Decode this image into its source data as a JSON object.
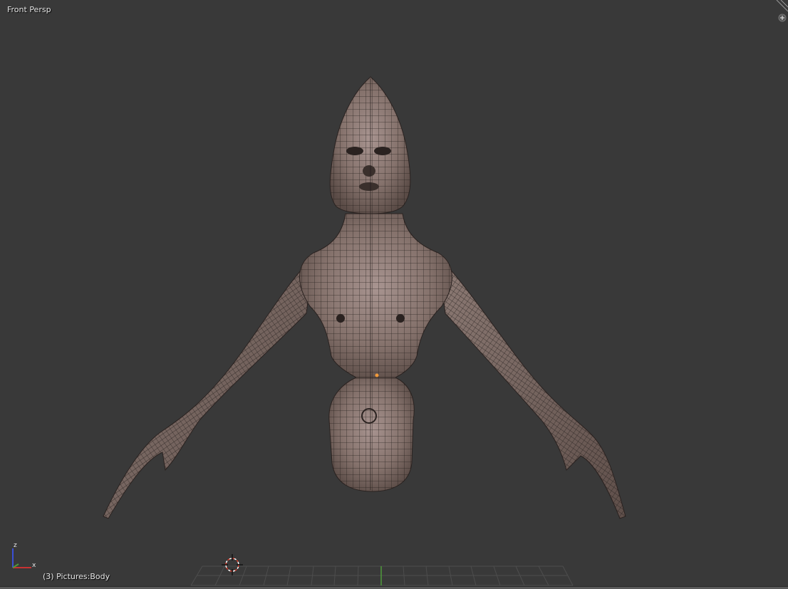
{
  "viewport": {
    "view_label": "Front Persp",
    "object_label": "(3) Pictures:Body"
  },
  "axis_gizmo": {
    "x_label": "x",
    "z_label": "z"
  },
  "colors": {
    "background": "#393939",
    "mesh_fill": "#7d6c66",
    "mesh_wire": "#1f1a18",
    "grid_line": "#4d4d4d",
    "grid_y_axis": "#4f9a3b",
    "cursor_red": "#d63a2a",
    "axis_x": "#c83232",
    "axis_z": "#3a4fd6"
  }
}
